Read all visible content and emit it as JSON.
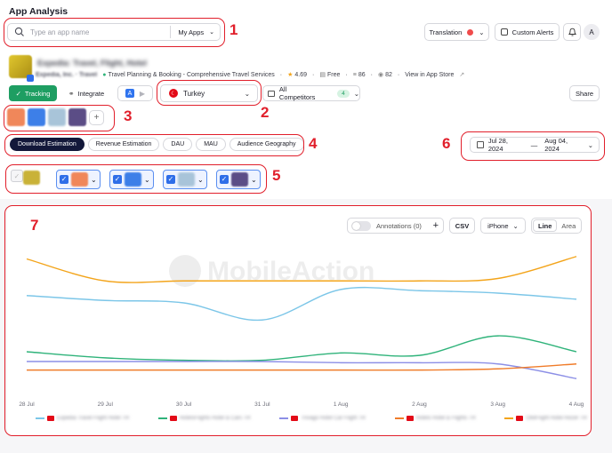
{
  "header": {
    "title": "App Analysis"
  },
  "search": {
    "placeholder": "Type an app name",
    "scope_label": "My Apps"
  },
  "top_right": {
    "translation_label": "Translation",
    "custom_alerts_label": "Custom Alerts",
    "avatar_initial": "A"
  },
  "app": {
    "name": "Expedia: Travel, Flight, Hotel",
    "developer": "Expedia, Inc. · Travel",
    "subtitle": "Travel Planning & Booking - Comprehensive Travel Services",
    "rating": "4.69",
    "price": "Free",
    "downloads": "86",
    "score": "82",
    "store_link": "View in App Store"
  },
  "actions": {
    "tracking_label": "Tracking",
    "integrate_label": "Integrate",
    "country": "Turkey",
    "competitors_label": "All Competitors",
    "competitors_count": "4",
    "share_label": "Share"
  },
  "metric_tabs": [
    "Download Estimation",
    "Revenue Estimation",
    "DAU",
    "MAU",
    "Audience Geography"
  ],
  "date_range": {
    "start": "Jul 28, 2024",
    "end": "Aug 04, 2024"
  },
  "chart_controls": {
    "annotations_label": "Annotations (0)",
    "csv_label": "CSV",
    "device": "iPhone",
    "line_label": "Line",
    "area_label": "Area"
  },
  "watermark": "MobileAction",
  "annotations": [
    "1",
    "2",
    "3",
    "4",
    "5",
    "6",
    "7"
  ],
  "colors": {
    "orange": "#f3a41a",
    "lightblue": "#7cc6e8",
    "green": "#2fb37a",
    "purple": "#8c8fe6",
    "darkorange": "#f07c2a",
    "tracking": "#1e9e62",
    "annot": "#e11f2b"
  },
  "chart_data": {
    "type": "line",
    "x": [
      "28 Jul",
      "29 Jul",
      "30 Jul",
      "31 Jul",
      "1 Aug",
      "2 Aug",
      "3 Aug",
      "4 Aug"
    ],
    "y_axis_labels": "none",
    "grid": false,
    "legend": "bottom",
    "series": [
      {
        "color": "#f3a41a",
        "values": [
          88,
          70,
          70,
          70,
          70,
          70,
          72,
          90
        ]
      },
      {
        "color": "#7cc6e8",
        "values": [
          58,
          54,
          52,
          38,
          63,
          62,
          60,
          55
        ]
      },
      {
        "color": "#2fb37a",
        "values": [
          12,
          7,
          5,
          5,
          11,
          9,
          25,
          12
        ]
      },
      {
        "color": "#8c8fe6",
        "values": [
          4,
          4,
          4,
          4,
          3,
          3,
          2,
          -10
        ]
      },
      {
        "color": "#f07c2a",
        "values": [
          -3,
          -3,
          -3,
          -3,
          -3,
          -3,
          -2,
          2
        ]
      }
    ]
  }
}
